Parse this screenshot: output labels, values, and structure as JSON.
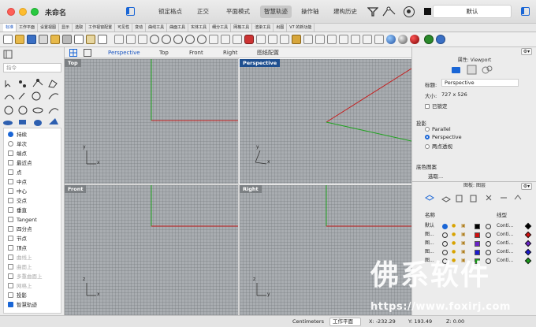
{
  "window": {
    "title": "未命名",
    "toolbar_buttons": [
      "锁定格点",
      "正交",
      "平面模式",
      "智慧轨迹",
      "操作轴",
      "建构历史"
    ],
    "active_toolbar_button": "智慧轨迹",
    "layer_name": "默认"
  },
  "tabs": [
    "标准",
    "工作平面",
    "设置视图",
    "显示",
    "选取",
    "工作视窗配置",
    "可见性",
    "变动",
    "曲线工具",
    "曲面工具",
    "实体工具",
    "细分工具",
    "网格工具",
    "渲染工具",
    "出图",
    "V7 的新功能"
  ],
  "active_tab": "标准",
  "command": {
    "placeholder": "指令"
  },
  "osnaps": [
    {
      "label": "持续",
      "type": "radio",
      "on": true,
      "dim": false
    },
    {
      "label": "单次",
      "type": "radio",
      "on": false,
      "dim": false
    },
    {
      "label": "端点",
      "type": "check",
      "on": false,
      "dim": false
    },
    {
      "label": "最近点",
      "type": "check",
      "on": false,
      "dim": false
    },
    {
      "label": "点",
      "type": "check",
      "on": false,
      "dim": false
    },
    {
      "label": "中点",
      "type": "check",
      "on": false,
      "dim": false
    },
    {
      "label": "中心",
      "type": "check",
      "on": false,
      "dim": false
    },
    {
      "label": "交点",
      "type": "check",
      "on": false,
      "dim": false
    },
    {
      "label": "垂直",
      "type": "check",
      "on": false,
      "dim": false
    },
    {
      "label": "Tangent",
      "type": "check",
      "on": false,
      "dim": false
    },
    {
      "label": "四分点",
      "type": "check",
      "on": false,
      "dim": false
    },
    {
      "label": "节点",
      "type": "check",
      "on": false,
      "dim": false
    },
    {
      "label": "顶点",
      "type": "check",
      "on": false,
      "dim": false
    },
    {
      "label": "曲线上",
      "type": "check",
      "on": false,
      "dim": true
    },
    {
      "label": "曲面上",
      "type": "check",
      "on": false,
      "dim": true
    },
    {
      "label": "多重曲面上",
      "type": "check",
      "on": false,
      "dim": true
    },
    {
      "label": "网格上",
      "type": "check",
      "on": false,
      "dim": true
    },
    {
      "label": "投影",
      "type": "check",
      "on": false,
      "dim": false
    },
    {
      "label": "智慧轨迹",
      "type": "check",
      "on": true,
      "dim": false
    }
  ],
  "viewport_tabs": [
    "Perspective",
    "Top",
    "Front",
    "Right",
    "图纸配置"
  ],
  "active_viewport_tab": "Perspective",
  "viewports": {
    "top": {
      "label": "Top",
      "x_axis": "x",
      "y_axis": "y"
    },
    "perspective": {
      "label": "Perspective",
      "x_axis": "x",
      "y_axis": "y"
    },
    "front": {
      "label": "Front",
      "x_axis": "x",
      "z_axis": "z"
    },
    "right": {
      "label": "Right",
      "y_axis": "y",
      "z_axis": "z"
    }
  },
  "properties": {
    "header": "属性: Viewport",
    "title_label": "标题:",
    "title_value": "Perspective",
    "size_label": "大小:",
    "size_value": "727 x 526",
    "locked_label": "已锁定",
    "projection_label": "投影",
    "projection_options": [
      "Parallel",
      "Perspective",
      "两点透视"
    ],
    "projection_selected": "Perspective",
    "wallpaper_label": "底色图案",
    "select_label": "选取..."
  },
  "layers": {
    "header": "图板: 图层",
    "col_name": "名称",
    "col_linetype": "线型",
    "rows": [
      {
        "name": "默认",
        "color": "#000000",
        "linetype": "Conti...",
        "print_color": "#000000"
      },
      {
        "name": "图...",
        "color": "#d01010",
        "linetype": "Conti...",
        "print_color": "#d01010"
      },
      {
        "name": "图...",
        "color": "#6a24c8",
        "linetype": "Conti...",
        "print_color": "#6a24c8"
      },
      {
        "name": "图...",
        "color": "#1a1ad0",
        "linetype": "Conti...",
        "print_color": "#1a1ad0"
      },
      {
        "name": "图...",
        "color": "#1a9a1a",
        "linetype": "Conti...",
        "print_color": "#1a9a1a"
      }
    ]
  },
  "status": {
    "units": "Centimeters",
    "plane": "工作平面",
    "x": "X: -232.29",
    "y": "Y: 193.49",
    "z": "Z: 0.00"
  },
  "watermark": {
    "logo_text": "佛系软件",
    "url": "https://www.foxirj.com"
  },
  "colors": {
    "accent": "#1a66d6",
    "viewport_bg": "#a9adb1",
    "x_axis": "#c41e1e",
    "y_axis": "#1ea31e",
    "active_viewport": "#1f4f8f"
  }
}
